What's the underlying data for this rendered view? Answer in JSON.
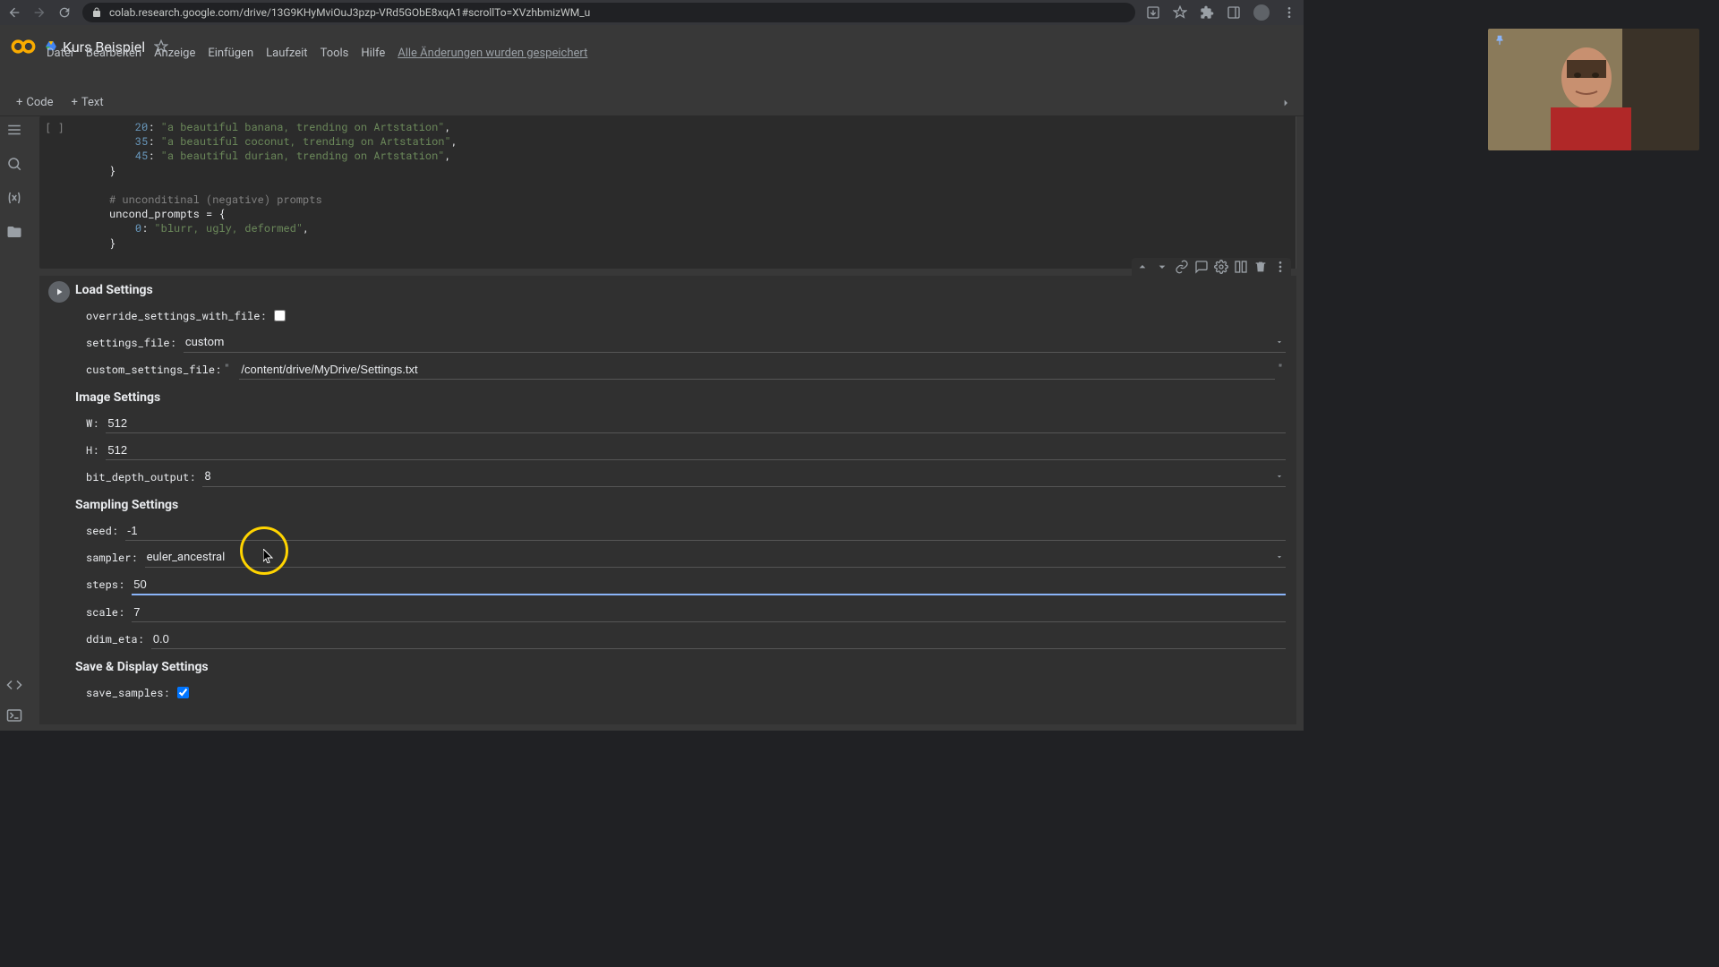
{
  "browser": {
    "url": "colab.research.google.com/drive/13G9KHyMviOuJ3pzp-VRd5GObE8xqA1#scrollTo=XVzhbmizWM_u"
  },
  "document": {
    "title": "Kurs Beispiel",
    "saved_message": "Alle Änderungen wurden gespeichert"
  },
  "menu": {
    "file": "Datei",
    "edit": "Bearbeiten",
    "view": "Anzeige",
    "insert": "Einfügen",
    "runtime": "Laufzeit",
    "tools": "Tools",
    "help": "Hilfe"
  },
  "toolbar": {
    "code": "Code",
    "text": "Text"
  },
  "code": {
    "l20_num": "20",
    "l20_str": "\"a beautiful banana, trending on Artstation\"",
    "l35_num": "35",
    "l35_str": "\"a beautiful coconut, trending on Artstation\"",
    "l45_num": "45",
    "l45_str": "\"a beautiful durian, trending on Artstation\"",
    "brace_close": "}",
    "comment": "# unconditinal (negative) prompts",
    "uncond": "uncond_prompts = {",
    "l0_num": "0",
    "l0_str": "\"blurr, ugly, deformed\""
  },
  "headings": {
    "load": "Load Settings",
    "image": "Image Settings",
    "sampling": "Sampling Settings",
    "save": "Save & Display Settings"
  },
  "labels": {
    "override": "override_settings_with_file:",
    "settings_file": "settings_file:",
    "custom_settings": "custom_settings_file:",
    "w": "W:",
    "h": "H:",
    "bit_depth": "bit_depth_output:",
    "seed": "seed:",
    "sampler": "sampler:",
    "steps": "steps:",
    "scale": "scale:",
    "ddim_eta": "ddim_eta:",
    "save_samples": "save_samples:"
  },
  "values": {
    "settings_file": "custom",
    "custom_settings": "/content/drive/MyDrive/Settings.txt",
    "w": "512",
    "h": "512",
    "bit_depth": "8",
    "seed": "-1",
    "sampler": "euler_ancestral",
    "steps": "50",
    "scale": "7",
    "ddim_eta": "0.0"
  },
  "cell_brackets": "[ ]"
}
